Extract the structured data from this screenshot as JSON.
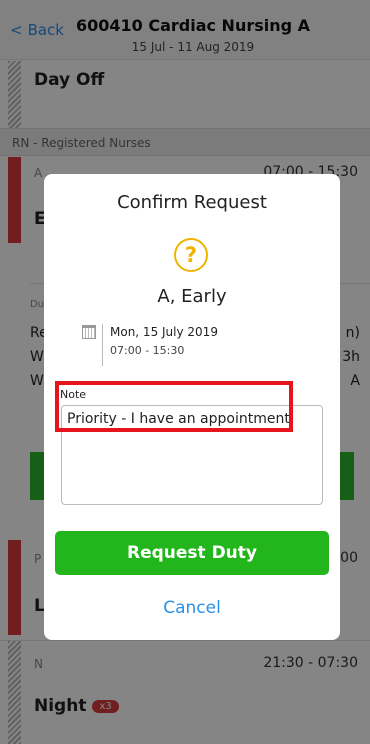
{
  "header": {
    "back_label": "Back",
    "back_chevron": "<",
    "title": "600410 Cardiac Nursing A",
    "subtitle": "15 Jul - 11 Aug 2019"
  },
  "roster": {
    "day_off_label": "Day Off",
    "section_label": "RN - Registered Nurses",
    "early_code": "A",
    "early_time": "07:00 - 15:30",
    "early_title_partial": "E",
    "duties_partial": "Du",
    "line1_left": "Re",
    "line1_right": "n)",
    "line2_left": "W",
    "line2_right": "3h",
    "line3_left": "W",
    "line3_right": "A",
    "late_code": "P",
    "late_time_partial": ":00",
    "late_title_partial": "L",
    "night_code": "N",
    "night_time": "21:30 - 07:30",
    "night_title": "Night",
    "night_badge": "x3"
  },
  "modal": {
    "title": "Confirm Request",
    "question_icon": "?",
    "duty_name": "A, Early",
    "date": "Mon, 15 July 2019",
    "time": "07:00 - 15:30",
    "note_label": "Note",
    "note_value": "Priority - I have an appointment",
    "request_button": "Request Duty",
    "cancel_button": "Cancel"
  },
  "colors": {
    "accent_blue": "#2a90e8",
    "request_green": "#22b51c",
    "warning_yellow": "#f0b400",
    "highlight_red": "#e8141b",
    "nurse_red": "#d93b3b"
  }
}
